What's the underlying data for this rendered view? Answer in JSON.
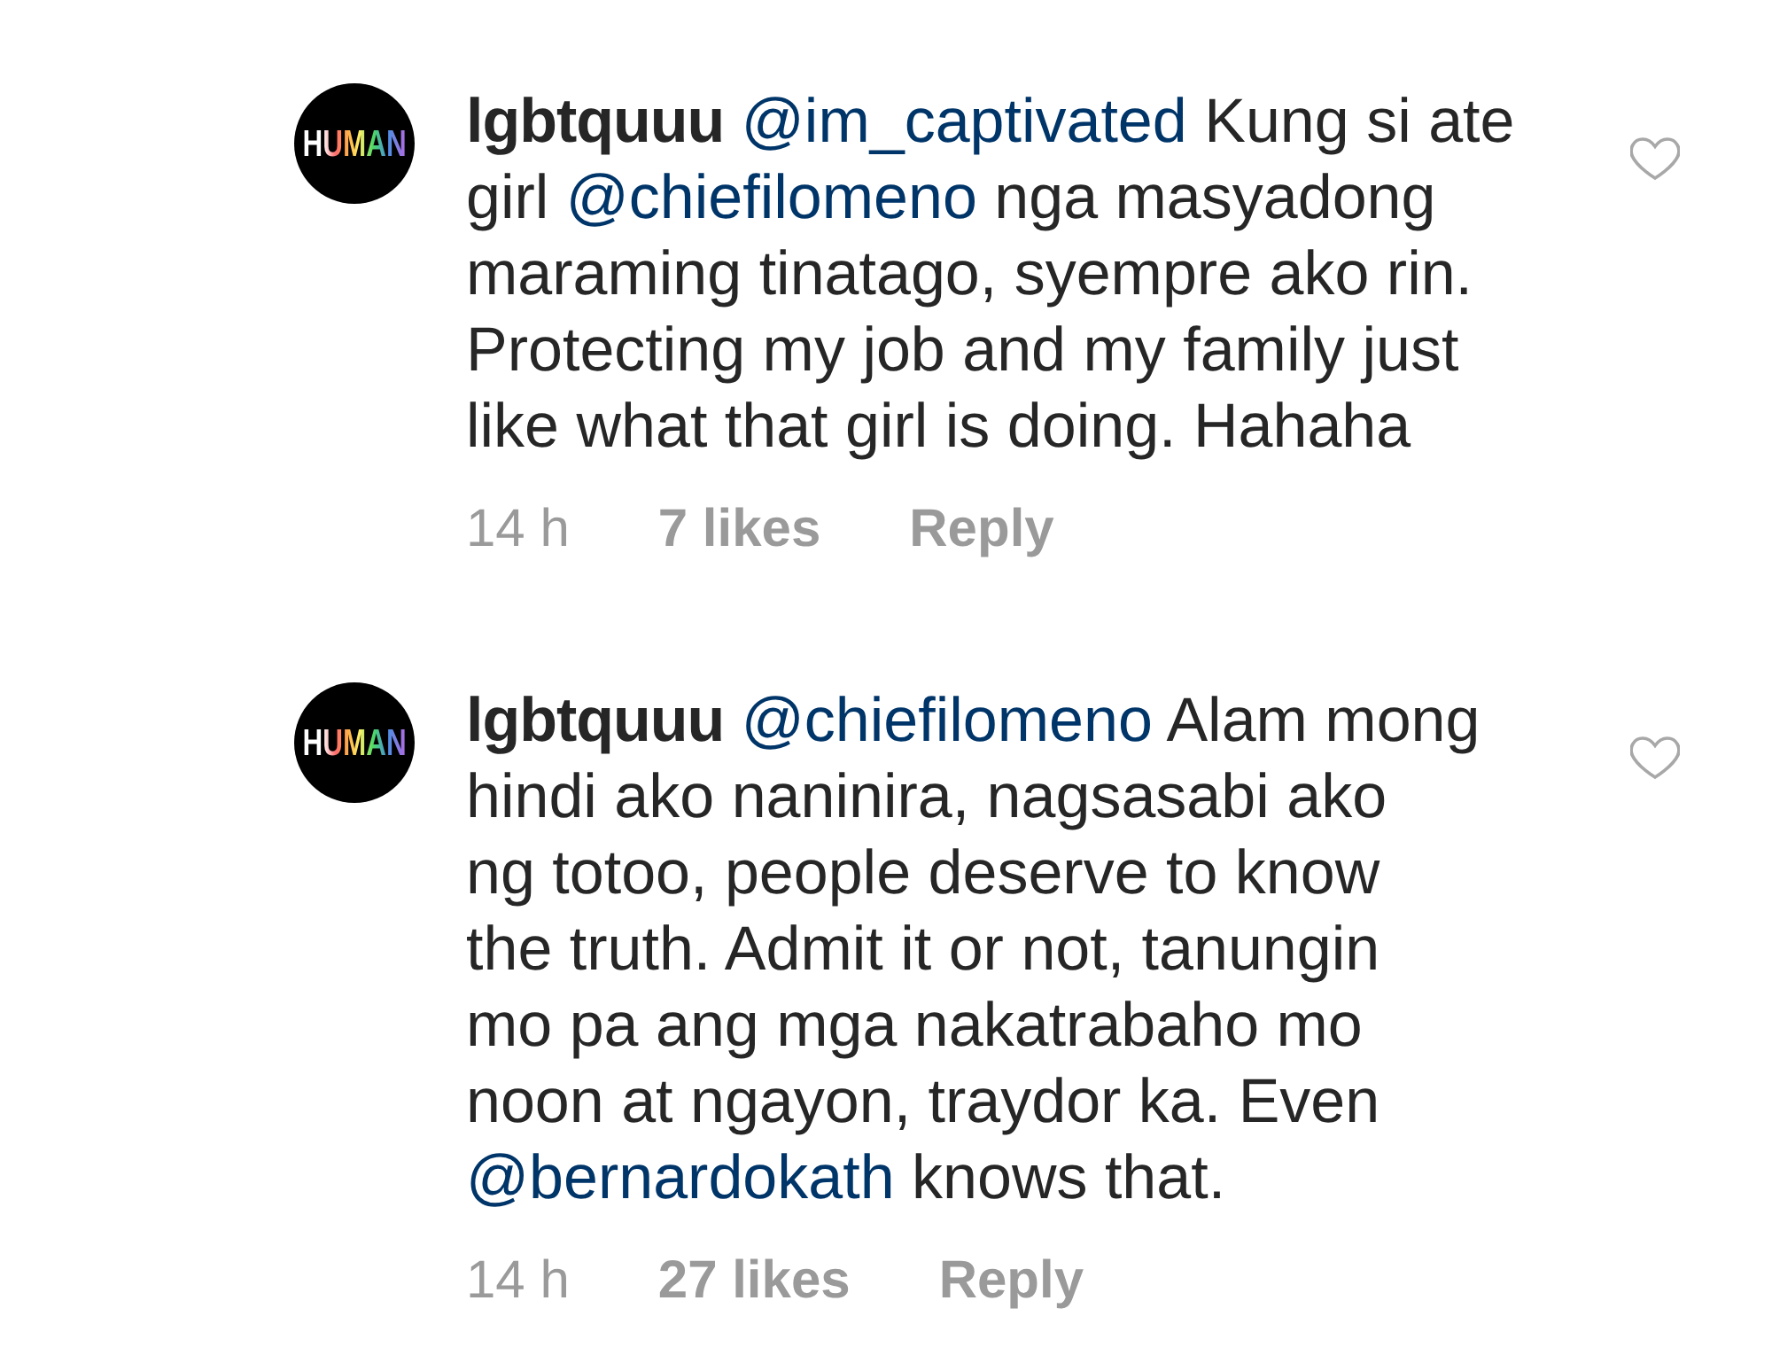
{
  "comments": [
    {
      "avatar_text": "HUMAN",
      "username": "lgbtquuu",
      "parts": [
        {
          "kind": "mention",
          "text": "@im_captivated"
        },
        {
          "kind": "text",
          "text": " Kung si ate\ngirl "
        },
        {
          "kind": "mention",
          "text": "@chiefilomeno"
        },
        {
          "kind": "text",
          "text": " nga masyadong\nmaraming tinatago, syempre ako rin.\nProtecting my job and my family just\nlike what that girl is doing. Hahaha"
        }
      ],
      "time": "14 h",
      "likes": "7 likes",
      "reply": "Reply",
      "liked": false
    },
    {
      "avatar_text": "HUMAN",
      "username": "lgbtquuu",
      "parts": [
        {
          "kind": "mention",
          "text": "@chiefilomeno"
        },
        {
          "kind": "text",
          "text": " Alam mong\nhindi ako naninira, nagsasabi ako\nng totoo, people deserve to know\nthe truth. Admit it or not, tanungin\nmo pa ang mga nakatrabaho mo\nnoon at ngayon, traydor ka. Even\n"
        },
        {
          "kind": "mention",
          "text": "@bernardokath"
        },
        {
          "kind": "text",
          "text": " knows that."
        }
      ],
      "time": "14 h",
      "likes": "27 likes",
      "reply": "Reply",
      "liked": false
    }
  ]
}
